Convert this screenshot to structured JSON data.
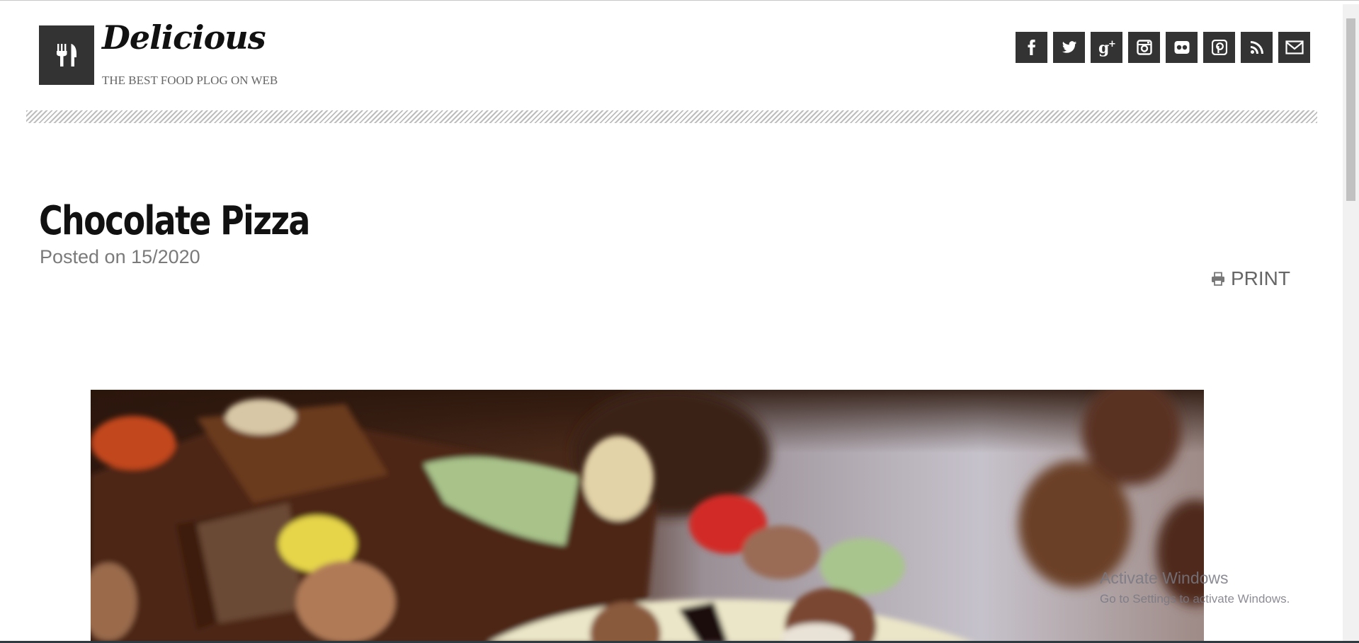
{
  "header": {
    "site_title": "Delicious",
    "tagline": "THE BEST FOOD PLOG ON WEB",
    "logo_icon": "fork-knife-icon"
  },
  "social": [
    {
      "name": "facebook",
      "icon": "facebook-icon"
    },
    {
      "name": "twitter",
      "icon": "twitter-icon"
    },
    {
      "name": "google-plus",
      "icon": "google-plus-icon"
    },
    {
      "name": "instagram",
      "icon": "instagram-icon"
    },
    {
      "name": "flickr",
      "icon": "flickr-icon"
    },
    {
      "name": "pinterest",
      "icon": "pinterest-icon"
    },
    {
      "name": "rss",
      "icon": "rss-icon"
    },
    {
      "name": "email",
      "icon": "mail-icon"
    }
  ],
  "post": {
    "title": "Chocolate Pizza",
    "meta": "Posted on 15/2020",
    "print_label": "PRINT",
    "hero_alt": "chocolate-pizza-photo"
  },
  "watermark": {
    "title": "Activate Windows",
    "subtitle": "Go to Settings to activate Windows."
  },
  "colors": {
    "icon_bg": "#333333",
    "text_dark": "#111111",
    "text_muted": "#7a7a7a"
  }
}
